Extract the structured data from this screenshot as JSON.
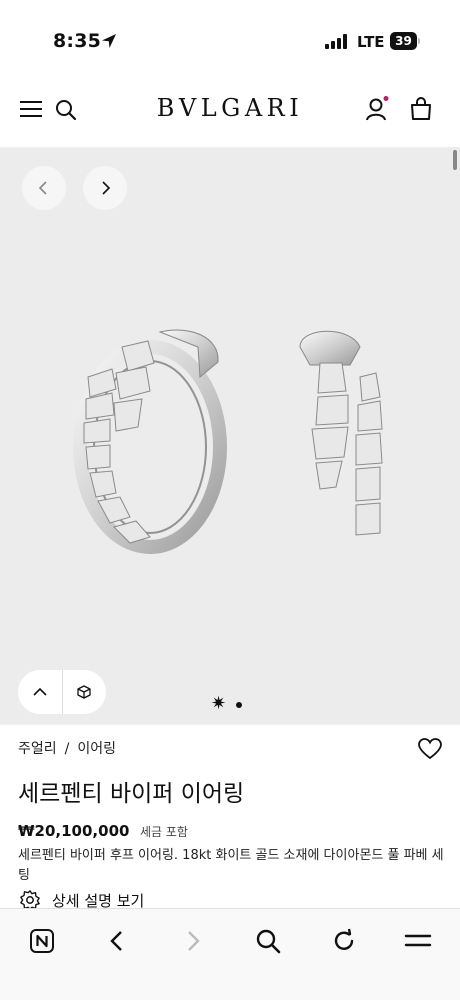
{
  "status_bar": {
    "time": "8:35",
    "carrier": "LTE",
    "battery": "39"
  },
  "header": {
    "logo": "BVLGARI",
    "icons": [
      "menu-icon",
      "search-icon",
      "account-icon",
      "bag-icon"
    ],
    "notification_dot_color": "#b0235d"
  },
  "gallery": {
    "background": "#ececec",
    "prev_icon": "chevron-left-icon",
    "next_icon": "chevron-right-icon",
    "pill_icons": [
      "chevron-up-icon",
      "3d-cube-icon"
    ]
  },
  "product": {
    "breadcrumb": [
      "주얼리",
      "이어링"
    ],
    "breadcrumb_separator": "/",
    "title": "세르펜티 바이퍼 이어링",
    "price": "₩20,100,000",
    "tax_note": "세금 포함",
    "description": "세르펜티 바이퍼 후프 이어링. 18kt 화이트 골드 소재에 다이아몬드 풀 파베 세팅",
    "details_link": "상세 설명 보기"
  },
  "toolbar": {
    "icons": [
      "n-app-icon",
      "back-icon",
      "forward-icon",
      "search-icon",
      "refresh-icon",
      "menu-icon"
    ]
  }
}
